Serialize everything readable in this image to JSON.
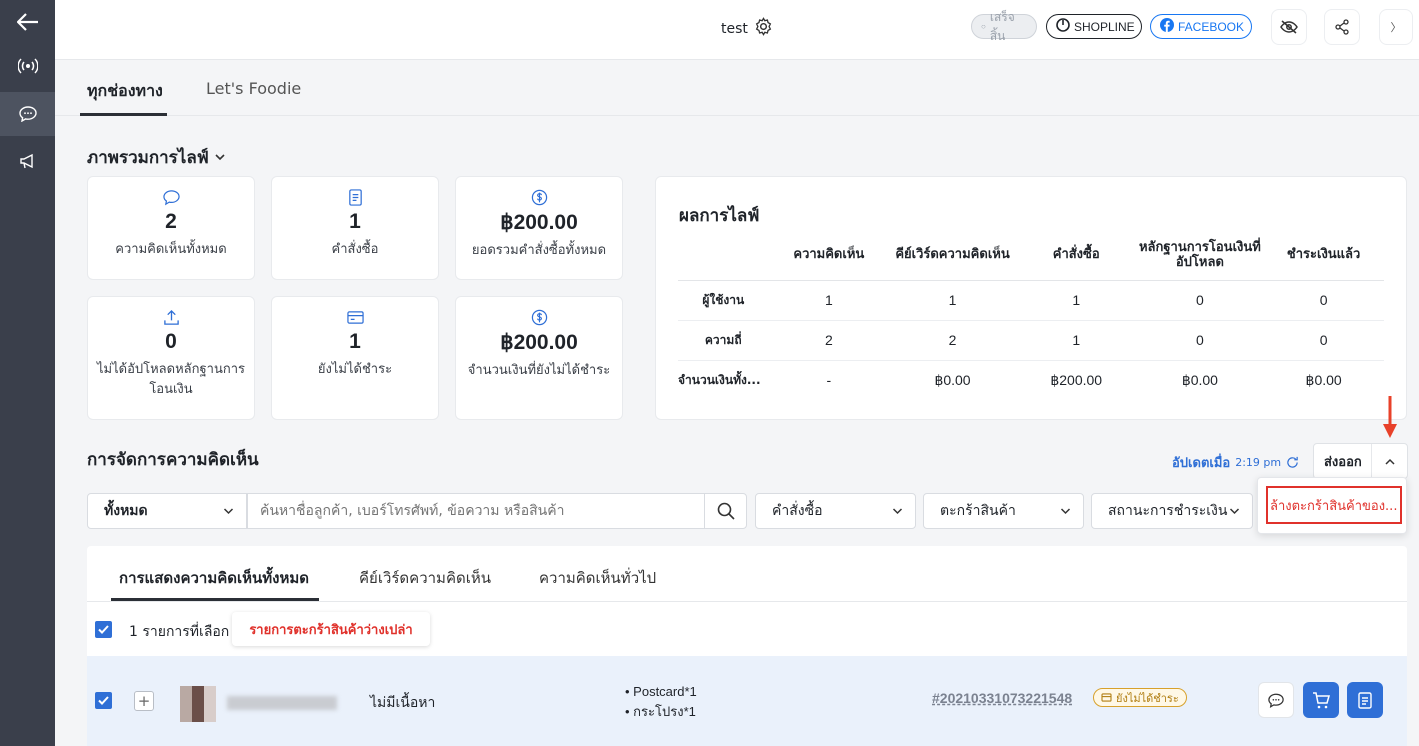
{
  "topbar": {
    "title": "test",
    "status_pill": "เสร็จสิ้น",
    "shopline_pill": "SHOPLINE",
    "facebook_pill": "FACEBOOK"
  },
  "channel_tabs": [
    "ทุกช่องทาง",
    "Let's Foodie"
  ],
  "overview": {
    "title": "ภาพรวมการไลฟ์",
    "stats": [
      {
        "icon": "comment-icon",
        "value": "2",
        "label": "ความคิดเห็นทั้งหมด"
      },
      {
        "icon": "receipt-icon",
        "value": "1",
        "label": "คำสั่งซื้อ"
      },
      {
        "icon": "dollar-icon",
        "value": "฿200.00",
        "label": "ยอดรวมคำสั่งซื้อทั้งหมด"
      },
      {
        "icon": "upload-icon",
        "value": "0",
        "label": "ไม่ได้อัปโหลดหลักฐานการโอนเงิน"
      },
      {
        "icon": "card-icon",
        "value": "1",
        "label": "ยังไม่ได้ชำระ"
      },
      {
        "icon": "dollar-icon",
        "value": "฿200.00",
        "label": "จำนวนเงินที่ยังไม่ได้ชำระ"
      }
    ]
  },
  "results": {
    "title": "ผลการไลฟ์",
    "columns": [
      "ความคิดเห็น",
      "คีย์เวิร์ดความคิดเห็น",
      "คำสั่งซื้อ",
      "หลักฐานการโอนเงินที่อัปโหลด",
      "ชำระเงินแล้ว"
    ],
    "rows": [
      {
        "label": "ผู้ใช้งาน",
        "values": [
          "1",
          "1",
          "1",
          "0",
          "0"
        ]
      },
      {
        "label": "ความถี่",
        "values": [
          "2",
          "2",
          "1",
          "0",
          "0"
        ]
      },
      {
        "label": "จำนวนเงินทั้ง...",
        "values": [
          "-",
          "฿0.00",
          "฿200.00",
          "฿0.00",
          "฿0.00"
        ]
      }
    ]
  },
  "comments": {
    "title": "การจัดการความคิดเห็น",
    "updated_label": "อัปเดตเมื่อ",
    "updated_time": "2:19 pm",
    "export_label": "ส่งออก",
    "export_menu_item": "ล้างตะกร้าสินค้าของ...",
    "filter_all": "ทั้งหมด",
    "search_placeholder": "ค้นหาชื่อลูกค้า, เบอร์โทรศัพท์, ข้อความ หรือสินค้า",
    "filter_order": "คำสั่งซื้อ",
    "filter_cart": "ตะกร้าสินค้า",
    "filter_payment": "สถานะการชำระเงิน",
    "tabs": [
      "การแสดงความคิดเห็นทั้งหมด",
      "คีย์เวิร์ดความคิดเห็น",
      "ความคิดเห็นทั่วไป"
    ],
    "selected_text": "1 รายการที่เลือก",
    "empty_cart_button": "รายการตะกร้าสินค้าว่างเปล่า",
    "row": {
      "content": "ไม่มีเนื้อหา",
      "items": [
        "• Postcard*1",
        "• กระโปรง*1"
      ],
      "order_id": "#20210331073221548",
      "status": "ยังไม่ได้ชำระ"
    }
  },
  "colors": {
    "accent": "#2f6fd6",
    "danger": "#e0312b",
    "rail": "#3a3f4b",
    "warning": "#b07d10"
  }
}
